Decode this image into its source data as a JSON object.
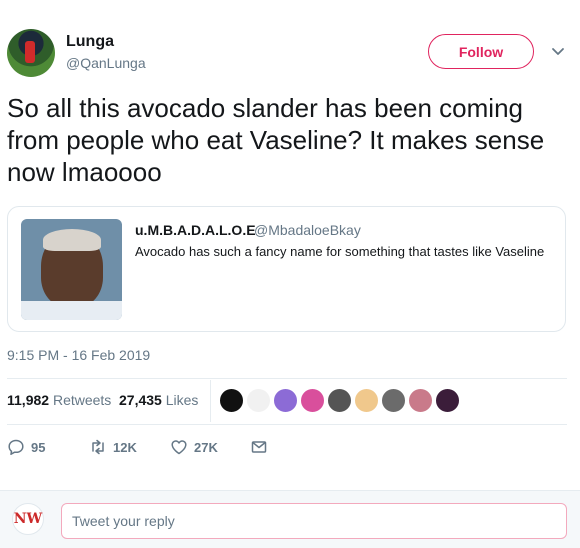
{
  "author": {
    "display_name": "Lunga",
    "handle": "@QanLunga"
  },
  "follow_label": "Follow",
  "tweet_text": "So all this avocado slander has been coming from people who eat Vaseline? It makes sense now lmaoooo",
  "quoted": {
    "display_name": "u.M.B.A.D.A.L.O.E",
    "handle": "@MbadaloeBkay",
    "text": "Avocado has such  a fancy name for something that tastes like Vaseline"
  },
  "timestamp": "9:15 PM - 16 Feb 2019",
  "stats": {
    "retweets_count": "11,982",
    "retweets_label": "Retweets",
    "likes_count": "27,435",
    "likes_label": "Likes"
  },
  "likers": [
    {
      "name": "liker-avatar",
      "color": "#111111"
    },
    {
      "name": "liker-avatar",
      "color": "#f1f1f1"
    },
    {
      "name": "liker-avatar",
      "color": "#8c6bd6"
    },
    {
      "name": "liker-avatar",
      "color": "#d94f9c"
    },
    {
      "name": "liker-avatar",
      "color": "#555555"
    },
    {
      "name": "liker-avatar",
      "color": "#f0c88c"
    },
    {
      "name": "liker-avatar",
      "color": "#6b6b6b"
    },
    {
      "name": "liker-avatar",
      "color": "#c97a8a"
    },
    {
      "name": "liker-avatar",
      "color": "#3b1d3a"
    }
  ],
  "actions": {
    "reply_count": "95",
    "retweet_count": "12K",
    "like_count": "27K"
  },
  "reply": {
    "avatar_text": "NW",
    "placeholder": "Tweet your reply"
  },
  "colors": {
    "accent": "#e0245e",
    "secondary_text": "#657786"
  }
}
